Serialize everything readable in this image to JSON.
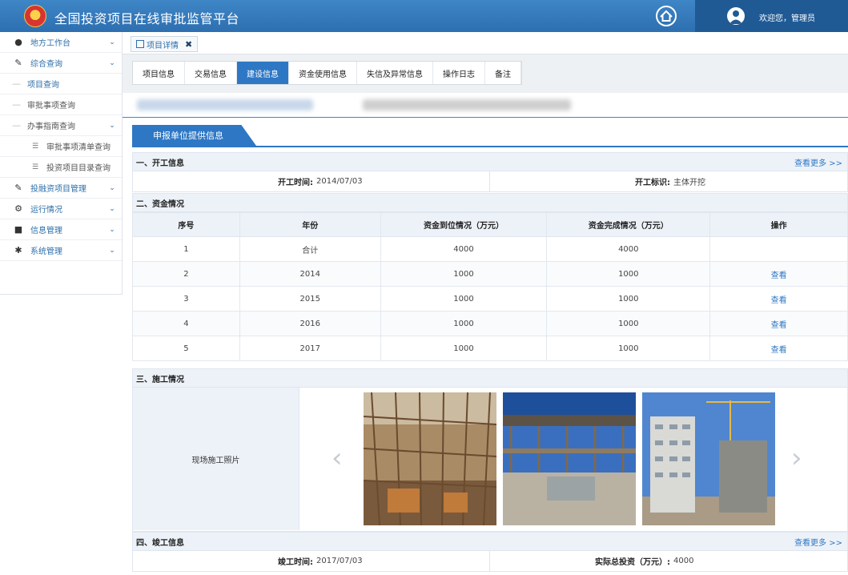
{
  "app": {
    "title": "全国投资项目在线审批监管平台",
    "welcome": "欢迎您，管理员"
  },
  "sidebar": {
    "items": [
      {
        "label": "地方工作台",
        "icon": "user-icon"
      },
      {
        "label": "综合查询",
        "icon": "edit-icon"
      },
      {
        "label": "项目查询"
      },
      {
        "label": "审批事项查询"
      },
      {
        "label": "办事指南查询"
      },
      {
        "label": "审批事项清单查询",
        "icon": "list-icon"
      },
      {
        "label": "投资项目目录查询",
        "icon": "list-icon"
      },
      {
        "label": "投融资项目管理",
        "icon": "edit-icon"
      },
      {
        "label": "运行情况",
        "icon": "gears-icon"
      },
      {
        "label": "信息管理",
        "icon": "folder-icon"
      },
      {
        "label": "系统管理",
        "icon": "gear-icon"
      }
    ]
  },
  "open_tab": {
    "label": "项目详情"
  },
  "subtabs": [
    {
      "label": "项目信息"
    },
    {
      "label": "交易信息"
    },
    {
      "label": "建设信息",
      "active": true
    },
    {
      "label": "资金使用信息"
    },
    {
      "label": "失信及异常信息"
    },
    {
      "label": "操作日志"
    },
    {
      "label": "备注"
    }
  ],
  "section_title": "申报单位提供信息",
  "start": {
    "heading": "一、开工信息",
    "more": "查看更多 >>",
    "time_label": "开工时间:",
    "time_value": "2014/07/03",
    "flag_label": "开工标识:",
    "flag_value": "主体开挖"
  },
  "funds": {
    "heading": "二、资金情况",
    "columns": [
      "序号",
      "年份",
      "资金到位情况（万元）",
      "资金完成情况（万元）",
      "操作"
    ],
    "rows": [
      [
        "1",
        "合计",
        "4000",
        "4000",
        ""
      ],
      [
        "2",
        "2014",
        "1000",
        "1000",
        "查看"
      ],
      [
        "3",
        "2015",
        "1000",
        "1000",
        "查看"
      ],
      [
        "4",
        "2016",
        "1000",
        "1000",
        "查看"
      ],
      [
        "5",
        "2017",
        "1000",
        "1000",
        "查看"
      ]
    ]
  },
  "construction": {
    "heading": "三、施工情况",
    "photo_label": "现场施工照片"
  },
  "completion": {
    "heading": "四、竣工信息",
    "more": "查看更多 >>",
    "time_label": "竣工时间:",
    "time_value": "2017/07/03",
    "invest_label": "实际总投资（万元）:",
    "invest_value": "4000"
  },
  "colors": {
    "primary": "#2e77c4",
    "header": "#3f86c7"
  }
}
